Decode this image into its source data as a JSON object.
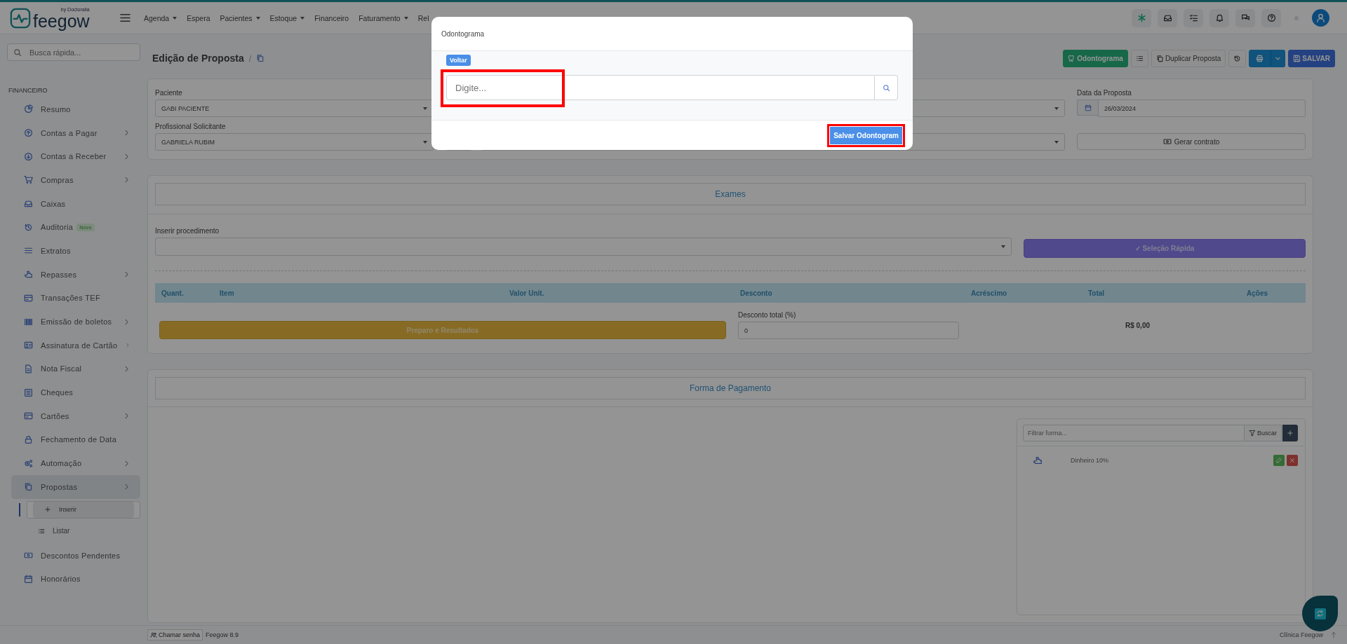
{
  "topbar": {
    "logo": "feegow",
    "logo_tagline": "by Doctoralia",
    "menu": [
      {
        "label": "Agenda",
        "dropdown": true
      },
      {
        "label": "Espera",
        "dropdown": false
      },
      {
        "label": "Pacientes",
        "dropdown": true
      },
      {
        "label": "Estoque",
        "dropdown": true
      },
      {
        "label": "Financeiro",
        "dropdown": false
      },
      {
        "label": "Faturamento",
        "dropdown": true
      },
      {
        "label": "Rel",
        "dropdown": false
      }
    ]
  },
  "sidebar": {
    "search_placeholder": "Busca rápida...",
    "section": "FINANCEIRO",
    "items": [
      {
        "label": "Resumo",
        "submenu": false
      },
      {
        "label": "Contas a Pagar",
        "submenu": true
      },
      {
        "label": "Contas a Receber",
        "submenu": true
      },
      {
        "label": "Compras",
        "submenu": true
      },
      {
        "label": "Caixas",
        "submenu": false
      },
      {
        "label": "Auditoria",
        "submenu": false,
        "badge": "Novo"
      },
      {
        "label": "Extratos",
        "submenu": false
      },
      {
        "label": "Repasses",
        "submenu": true
      },
      {
        "label": "Transações TEF",
        "submenu": false
      },
      {
        "label": "Emissão de boletos",
        "submenu": true
      },
      {
        "label": "Assinatura de Cartão",
        "submenu": true
      },
      {
        "label": "Nota Fiscal",
        "submenu": true
      },
      {
        "label": "Cheques",
        "submenu": false
      },
      {
        "label": "Cartões",
        "submenu": true
      },
      {
        "label": "Fechamento de Data",
        "submenu": false
      },
      {
        "label": "Automação",
        "submenu": true
      },
      {
        "label": "Propostas",
        "submenu": true,
        "expanded": true,
        "children": [
          {
            "label": "Inserir",
            "selected": true
          },
          {
            "label": "Listar",
            "selected": false
          }
        ]
      },
      {
        "label": "Descontos Pendentes",
        "submenu": false
      },
      {
        "label": "Honorários",
        "submenu": false
      }
    ]
  },
  "header": {
    "title": "Edição de Proposta",
    "separator": "/",
    "odontograma_button": "Odontograma",
    "duplicate_button": "Duplicar Proposta",
    "save_button": "SALVAR"
  },
  "form": {
    "fields": [
      {
        "label": "Paciente",
        "value": "GABI PACIENTE"
      },
      {
        "label": "Profissional Solicitante",
        "value": "GABRIELA RUBIM"
      }
    ],
    "date": {
      "label": "Data da Proposta",
      "value": "26/03/2024"
    },
    "contract_button": "Gerar contrato"
  },
  "exams": {
    "title": "Exames",
    "procedure_label": "Inserir procedimento",
    "quick_select": "✓ Seleção Rápida",
    "columns": [
      "Quant.",
      "Item",
      "Valor Unit.",
      "Desconto",
      "Acréscimo",
      "Total",
      "Ações"
    ],
    "prep_button": "Preparo e Resultados",
    "discount_label": "Desconto total (%)",
    "discount_value": "0",
    "total": "R$ 0,00"
  },
  "payment": {
    "title": "Forma de Pagamento",
    "filter_placeholder": "Filtrar forma...",
    "search_button": "Buscar",
    "methods": [
      {
        "label": "Dinheiro 10%"
      }
    ]
  },
  "footer": {
    "call_button": "Chamar senha",
    "version": "Feegow 8.9",
    "clinic": "Clínica Feegow"
  },
  "modal": {
    "title": "Odontograma",
    "back_badge": "Voltar",
    "search_placeholder": "Digite...",
    "save_button": "Salvar Odontogram"
  }
}
